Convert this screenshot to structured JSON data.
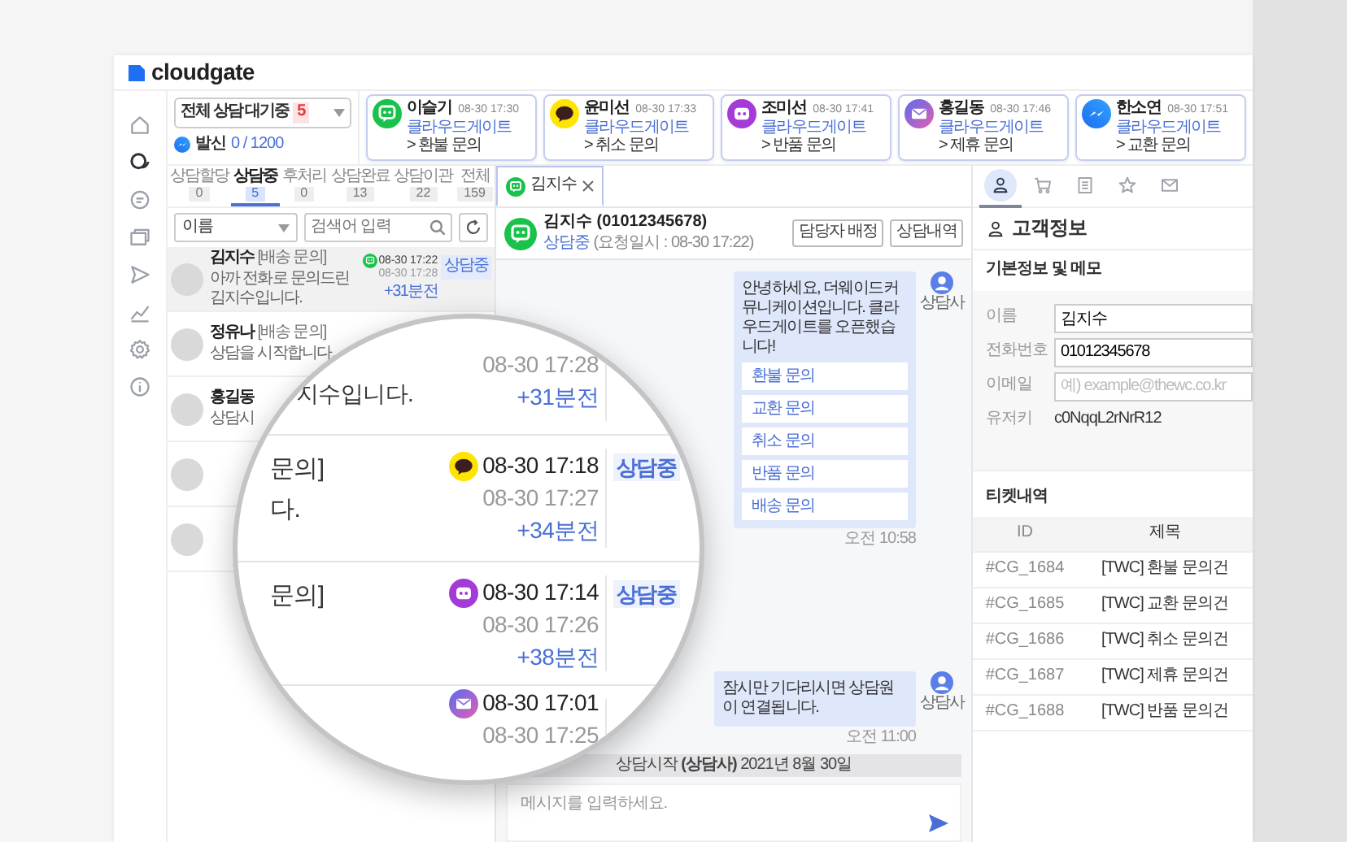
{
  "app": {
    "logo": "cloudgate"
  },
  "nav_rail": [
    {
      "kind": "home",
      "selected": false
    },
    {
      "kind": "chat",
      "selected": true
    },
    {
      "kind": "message",
      "selected": false
    },
    {
      "kind": "windows",
      "selected": false
    },
    {
      "kind": "send",
      "selected": false
    },
    {
      "kind": "chart",
      "selected": false
    },
    {
      "kind": "settings",
      "selected": false
    },
    {
      "kind": "info",
      "selected": false
    }
  ],
  "queue_filter": {
    "label": "전체 상담 대기중",
    "count": "5",
    "outbound_label": "발신",
    "outbound_count": "0 / 1200"
  },
  "waiting_cards": [
    {
      "name": "이슬기",
      "time": "08-30 17:30",
      "source": "클라우드게이트",
      "topic": "> 환불 문의",
      "kind": "line"
    },
    {
      "name": "윤미선",
      "time": "08-30 17:33",
      "source": "클라우드게이트",
      "topic": "> 취소 문의",
      "kind": "kakao"
    },
    {
      "name": "조미선",
      "time": "08-30 17:41",
      "source": "클라우드게이트",
      "topic": "> 반품 문의",
      "kind": "purple"
    },
    {
      "name": "홍길동",
      "time": "08-30 17:46",
      "source": "클라우드게이트",
      "topic": "> 제휴 문의",
      "kind": "mail"
    },
    {
      "name": "한소연",
      "time": "08-30 17:51",
      "source": "클라우드게이트",
      "topic": "> 교환 문의",
      "kind": "messenger"
    }
  ],
  "list_tabs": [
    {
      "label": "상담할당",
      "count": "0",
      "selected": false
    },
    {
      "label": "상담중",
      "count": "5",
      "selected": true
    },
    {
      "label": "후처리",
      "count": "0",
      "selected": false
    },
    {
      "label": "상담완료",
      "count": "13",
      "selected": false
    },
    {
      "label": "상담이관",
      "count": "22",
      "selected": false
    },
    {
      "label": "전체",
      "count": "159",
      "selected": false
    }
  ],
  "list_filter": {
    "field": "이름",
    "search_placeholder": "검색어 입력"
  },
  "conversations": [
    {
      "name": "김지수",
      "category": "[배송 문의]",
      "preview": "아까 전화로 문의드린 김지수입니다.",
      "kind": "line",
      "requested": "08-30 17:22",
      "updated": "08-30 17:28",
      "elapsed": "+31분전",
      "status": "상담중",
      "selected": true
    },
    {
      "name": "정유나",
      "category": "[배송 문의]",
      "preview": "상담을 시작합니다.",
      "selected": false
    },
    {
      "name": "홍길동",
      "preview": "상담시",
      "selected": false
    },
    {
      "selected": false
    },
    {
      "selected": false
    }
  ],
  "magnifier": {
    "rows": [
      {
        "fragments": [
          "지수입니다."
        ],
        "updated": "08-30 17:28",
        "elapsed": "+31분전"
      },
      {
        "fragments": [
          "문의]",
          "다."
        ],
        "kind": "kakao",
        "requested": "08-30 17:18",
        "updated": "08-30 17:27",
        "elapsed": "+34분전",
        "status": "상담중"
      },
      {
        "fragments": [
          "문의]"
        ],
        "kind": "purple",
        "requested": "08-30 17:14",
        "updated": "08-30 17:26",
        "elapsed": "+38분전",
        "status": "상담중"
      },
      {
        "kind": "mail",
        "requested": "08-30 17:01",
        "updated": "08-30 17:25"
      }
    ]
  },
  "chat_tabs": [
    {
      "name": "김지수",
      "kind": "line",
      "selected": true
    }
  ],
  "chat_header": {
    "title": "김지수 (01012345678)",
    "status": "상담중",
    "detail": "(요청일시 : 08-30 17:22)",
    "kind": "line",
    "buttons": [
      "담당자 배정",
      "상담내역"
    ]
  },
  "messages": [
    {
      "kind": "menu",
      "text": "안녕하세요, 더웨이드커뮤니케이션입니다. 클라우드게이트를 오픈했습니다!",
      "options": [
        "환불 문의",
        "교환 문의",
        "취소 문의",
        "반품 문의",
        "배송 문의"
      ],
      "sender": "상담사",
      "time": "오전 10:58"
    },
    {
      "kind": "text",
      "text": "잠시만 기다리시면 상담원이 연결됩니다.",
      "sender": "상담사",
      "time": "오전 11:00"
    }
  ],
  "system_notice": "상담시작 **(상담사)** 2021년 8월 30일",
  "composer": {
    "placeholder": "메시지를 입력하세요."
  },
  "customer_panel": {
    "tabs": [
      {
        "kind": "person",
        "selected": true
      },
      {
        "kind": "cart",
        "selected": false
      },
      {
        "kind": "document",
        "selected": false
      },
      {
        "kind": "star",
        "selected": false
      },
      {
        "kind": "mail",
        "selected": false
      }
    ],
    "title": "고객정보",
    "section": "기본정보 및 메모",
    "fields": [
      {
        "label": "이름",
        "kind": "input",
        "value": "김지수"
      },
      {
        "label": "전화번호",
        "kind": "input",
        "value": "01012345678"
      },
      {
        "label": "이메일",
        "kind": "input",
        "placeholder": "예) example@thewc.co.kr"
      },
      {
        "label": "유저키",
        "kind": "text",
        "value": "c0NqqL2rNrR12"
      }
    ],
    "tickets_title": "티켓내역",
    "ticket_columns": [
      "ID",
      "제목"
    ],
    "tickets": [
      [
        "#CG_1684",
        "[TWC] 환불 문의건"
      ],
      [
        "#CG_1685",
        "[TWC] 교환 문의건"
      ],
      [
        "#CG_1686",
        "[TWC] 취소 문의건"
      ],
      [
        "#CG_1687",
        "[TWC] 제휴 문의건"
      ],
      [
        "#CG_1688",
        "[TWC] 반품 문의건"
      ]
    ]
  }
}
